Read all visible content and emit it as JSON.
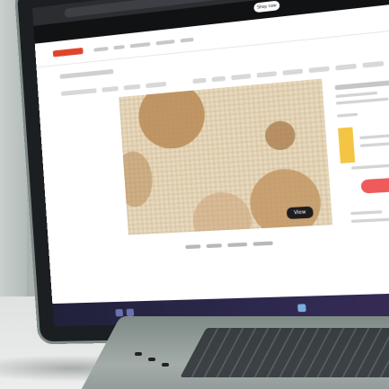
{
  "photo": {
    "subject": "laptop-showing-rug-product-page"
  },
  "screen": {
    "promo_button_label": "Shop now",
    "view_badge_label": "View",
    "colors": {
      "promo_bar": "#111214",
      "brand_logo": "#e0452a",
      "cart_button": "#ef5b5b",
      "swatch": "#f4c542",
      "rug_base": "#e8d9bd",
      "rug_circles": "#b98a55"
    }
  }
}
